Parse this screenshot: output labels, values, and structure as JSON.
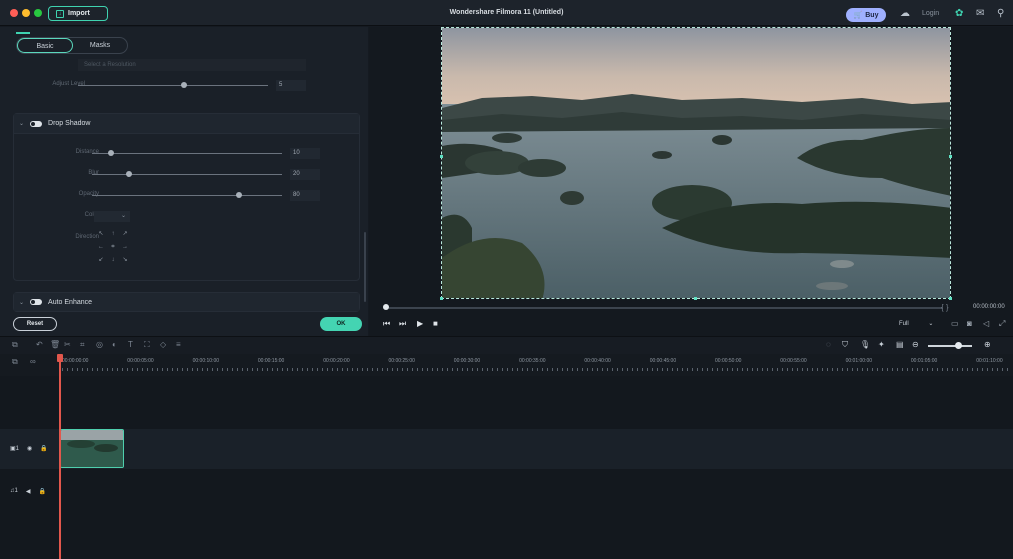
{
  "app": {
    "title": "Wondershare Filmora 11 (Untitled)",
    "import_label": "Import",
    "buy_label": "Buy",
    "login_label": "Login"
  },
  "colors": {
    "accent": "#3fd3b0",
    "buy": "#9fb0ff",
    "playhead": "#e2574c",
    "close": "#ff5f57",
    "minimize": "#febc2e",
    "maximize": "#28c840"
  },
  "left_panel": {
    "tabs": [
      {
        "label": "Basic",
        "active": true
      },
      {
        "label": "Masks",
        "active": false
      }
    ],
    "resolution_placeholder": "Select a Resolution",
    "adjust_level": {
      "label": "Adjust Level",
      "value": "5",
      "fraction": 0.48
    },
    "drop_shadow": {
      "title": "Drop Shadow",
      "enabled": true,
      "distance": {
        "label": "Distance",
        "value": "10",
        "fraction": 0.1
      },
      "blur": {
        "label": "Blur",
        "value": "20",
        "fraction": 0.2
      },
      "opacity": {
        "label": "Opacity",
        "value": "80",
        "fraction": 0.8
      },
      "color_label": "Color",
      "direction_label": "Direction",
      "direction_glyphs": [
        "↖",
        "↑",
        "↗",
        "←",
        "⌗",
        "→",
        "↙",
        "↓",
        "↘"
      ]
    },
    "auto_enhance": {
      "title": "Auto Enhance",
      "enabled": true
    },
    "reset_label": "Reset",
    "ok_label": "OK"
  },
  "preview": {
    "timecode": "00:00:00:00",
    "quality": "Full",
    "braces": "{  }"
  },
  "timeline": {
    "ruler_labels": [
      "00:00:00:00",
      "00:00:05:00",
      "00:00:10:00",
      "00:00:15:00",
      "00:00:20:00",
      "00:00:25:00",
      "00:00:30:00",
      "00:00:35:00",
      "00:00:40:00",
      "00:00:45:00",
      "00:00:50:00",
      "00:00:55:00",
      "00:01:00:00",
      "00:01:05:00",
      "00:01:10:00"
    ],
    "video_track": "1",
    "audio_track": "1"
  }
}
